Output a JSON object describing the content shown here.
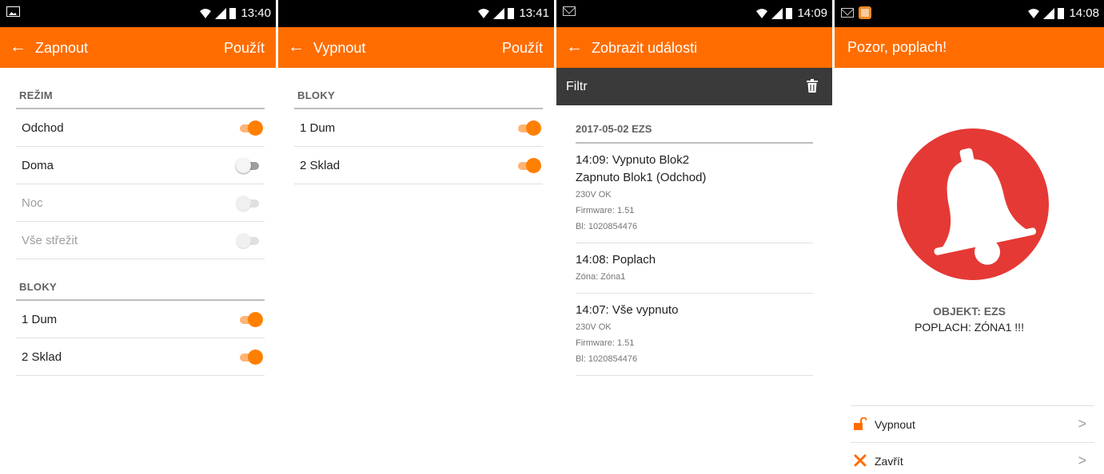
{
  "screen1": {
    "status_time": "13:40",
    "back_arrow": "←",
    "title": "Zapnout",
    "action": "Použít",
    "mode_header": "REŽIM",
    "modes": [
      {
        "label": "Odchod",
        "state": "on"
      },
      {
        "label": "Doma",
        "state": "off"
      },
      {
        "label": "Noc",
        "state": "disabled"
      },
      {
        "label": "Vše střežit",
        "state": "disabled"
      }
    ],
    "blocks_header": "BLOKY",
    "blocks": [
      {
        "label": "1 Dum",
        "state": "on"
      },
      {
        "label": "2 Sklad",
        "state": "on"
      }
    ]
  },
  "screen2": {
    "status_time": "13:41",
    "back_arrow": "←",
    "title": "Vypnout",
    "action": "Použít",
    "blocks_header": "BLOKY",
    "blocks": [
      {
        "label": "1 Dum",
        "state": "on"
      },
      {
        "label": "2 Sklad",
        "state": "on"
      }
    ]
  },
  "screen3": {
    "status_time": "14:09",
    "back_arrow": "←",
    "title": "Zobrazit události",
    "filter_label": "Filtr",
    "date_header": "2017-05-02 EZS",
    "events": [
      {
        "lines": [
          "14:09: Vypnuto Blok2",
          "Zapnuto Blok1 (Odchod)"
        ],
        "details": [
          "230V OK",
          "Firmware: 1.51",
          "Bl: 1020854476"
        ]
      },
      {
        "lines": [
          "14:08: Poplach"
        ],
        "details": [
          "Zóna: Zóna1"
        ]
      },
      {
        "lines": [
          "14:07: Vše vypnuto"
        ],
        "details": [
          "230V OK",
          "Firmware: 1.51",
          "Bl: 1020854476"
        ]
      }
    ]
  },
  "screen4": {
    "status_time": "14:08",
    "title": "Pozor, poplach!",
    "object_text": "OBJEKT: EZS",
    "alarm_text": "POPLACH: ZÓNA1 !!!",
    "actions": [
      {
        "label": "Vypnout",
        "icon": "unlock-icon",
        "chevron": ">"
      },
      {
        "label": "Zavřít",
        "icon": "close-icon",
        "chevron": ">"
      }
    ]
  },
  "colors": {
    "appbar": "#ff6d00",
    "switch_on": "#ff8000",
    "bell_circle": "#e53935",
    "filterbar": "#3a3a3a"
  }
}
